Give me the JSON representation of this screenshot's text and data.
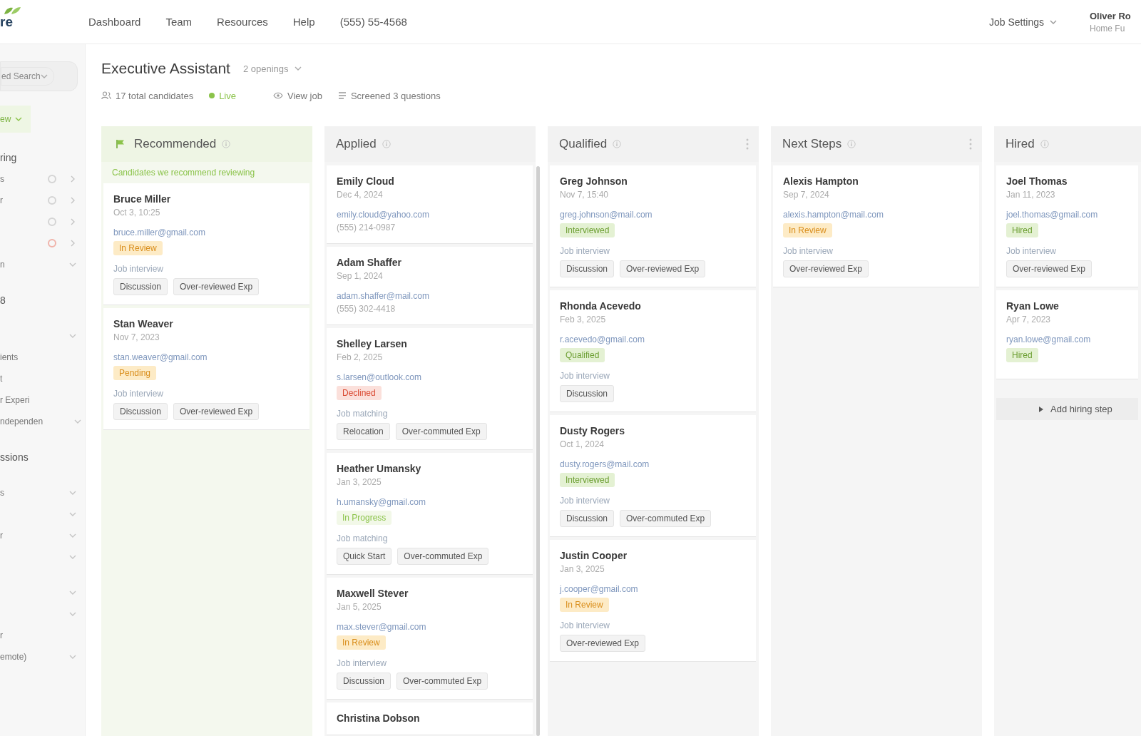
{
  "topbar": {
    "logo_text": "re",
    "nav": [
      "Dashboard",
      "Team",
      "Resources",
      "Help",
      "(555) 55-4568"
    ],
    "settings": "Job Settings",
    "user": {
      "name": "Oliver Ro",
      "company": "Home Fu"
    }
  },
  "sidebar": {
    "groups": [
      {
        "items": [
          {
            "kind": "dropdown",
            "text": "ed Search"
          }
        ]
      },
      {
        "items": [
          {
            "kind": "tag",
            "text": "ew"
          }
        ]
      },
      {
        "items": [
          {
            "kind": "heading",
            "text": "ring"
          },
          {
            "kind": "status",
            "text": "s",
            "color": "#d4d4d4"
          },
          {
            "kind": "status",
            "text": "r",
            "color": "#d4d4d4"
          },
          {
            "kind": "status",
            "color": "#d4d4d4"
          },
          {
            "kind": "status",
            "color": "#f0b3aa"
          },
          {
            "kind": "toggle",
            "text": "n"
          }
        ]
      },
      {
        "items": [
          {
            "kind": "heading",
            "text": "8"
          }
        ]
      },
      {
        "items": [
          {
            "kind": "toggle"
          },
          {
            "kind": "option",
            "text": "ients"
          },
          {
            "kind": "option",
            "text": "t"
          },
          {
            "kind": "option",
            "text": "r Experi"
          },
          {
            "kind": "toggle",
            "text": "ndependen"
          }
        ]
      },
      {
        "items": [
          {
            "kind": "heading",
            "text": "ssions"
          }
        ]
      },
      {
        "items": [
          {
            "kind": "toggle",
            "text": "s"
          },
          {
            "kind": "toggle"
          },
          {
            "kind": "toggle",
            "text": "r"
          },
          {
            "kind": "toggle"
          }
        ]
      },
      {
        "items": [
          {
            "kind": "toggle"
          },
          {
            "kind": "toggle"
          },
          {
            "kind": "option",
            "text": "r"
          },
          {
            "kind": "toggle",
            "text": "emote)"
          }
        ]
      }
    ]
  },
  "job": {
    "title": "Executive Assistant",
    "openings": "2 openings",
    "meta": [
      {
        "kind": "count",
        "text": "17 total candidates"
      },
      {
        "kind": "live",
        "text": "Live"
      },
      {
        "kind": "view",
        "text": "View job"
      },
      {
        "kind": "questions",
        "text": "Screened 3 questions"
      }
    ]
  },
  "columns": [
    {
      "kind": "recommended",
      "title": "Recommended",
      "note": "Candidates we recommend reviewing",
      "menu": false,
      "scrollable": false,
      "cards": [
        {
          "name": "Bruce Miller",
          "date": "Oct 3, 10:25",
          "email": "bruce.miller@gmail.com",
          "status": {
            "kind": "review",
            "label": "In Review"
          },
          "label": "Job interview",
          "tags": [
            "Discussion",
            "Over-reviewed Exp"
          ]
        },
        {
          "name": "Stan Weaver",
          "date": "Nov 7, 2023",
          "email": "stan.weaver@gmail.com",
          "status": {
            "kind": "review",
            "label": "Pending"
          },
          "label": "Job interview",
          "tags": [
            "Discussion",
            "Over-reviewed Exp"
          ]
        }
      ]
    },
    {
      "kind": "stage",
      "title": "Applied",
      "menu": false,
      "scrollable": true,
      "cards": [
        {
          "name": "Emily Cloud",
          "date": "Dec 4, 2024",
          "email": "emily.cloud@yahoo.com",
          "phone": "(555) 214-0987"
        },
        {
          "name": "Adam Shaffer",
          "date": "Sep 1, 2024",
          "email": "adam.shaffer@mail.com",
          "phone": "(555) 302-4418"
        },
        {
          "name": "Shelley Larsen",
          "date": "Feb 2, 2025",
          "email": "s.larsen@outlook.com",
          "status": {
            "kind": "declined",
            "label": "Declined"
          },
          "label": "Job matching",
          "tags": [
            "Relocation",
            "Over-commuted Exp"
          ]
        },
        {
          "name": "Heather Umansky",
          "date": "Jan 3, 2025",
          "email": "h.umansky@gmail.com",
          "status": {
            "kind": "progress",
            "label": "In Progress"
          },
          "label": "Job matching",
          "tags": [
            "Quick Start",
            "Over-commuted Exp"
          ]
        },
        {
          "name": "Maxwell Stever",
          "date": "Jan 5, 2025",
          "email": "max.stever@gmail.com",
          "status": {
            "kind": "review",
            "label": "In Review"
          },
          "label": "Job interview",
          "tags": [
            "Discussion",
            "Over-commuted Exp"
          ]
        },
        {
          "name": "Christina Dobson"
        }
      ]
    },
    {
      "kind": "stage",
      "title": "Qualified",
      "menu": true,
      "scrollable": false,
      "cards": [
        {
          "name": "Greg Johnson",
          "date": "Nov 7, 15:40",
          "email": "greg.johnson@mail.com",
          "status": {
            "kind": "qualified",
            "label": "Interviewed"
          },
          "label": "Job interview",
          "tags": [
            "Discussion",
            "Over-reviewed Exp"
          ]
        },
        {
          "name": "Rhonda Acevedo",
          "date": "Feb 3, 2025",
          "email": "r.acevedo@gmail.com",
          "status": {
            "kind": "qualified",
            "label": "Qualified"
          },
          "label": "Job interview",
          "tags": [
            "Discussion"
          ]
        },
        {
          "name": "Dusty Rogers",
          "date": "Oct 1, 2024",
          "email": "dusty.rogers@mail.com",
          "status": {
            "kind": "qualified",
            "label": "Interviewed"
          },
          "label": "Job interview",
          "tags": [
            "Discussion",
            "Over-commuted Exp"
          ]
        },
        {
          "name": "Justin Cooper",
          "date": "Jan 3, 2025",
          "email": "j.cooper@gmail.com",
          "status": {
            "kind": "review",
            "label": "In Review"
          },
          "label": "Job interview",
          "tags": [
            "Over-reviewed Exp"
          ]
        }
      ]
    },
    {
      "kind": "stage",
      "title": "Next Steps",
      "menu": true,
      "scrollable": false,
      "cards": [
        {
          "name": "Alexis Hampton",
          "date": "Sep 7, 2024",
          "email": "alexis.hampton@mail.com",
          "status": {
            "kind": "review",
            "label": "In Review"
          },
          "label": "Job interview",
          "tags": [
            "Over-reviewed Exp"
          ]
        }
      ]
    },
    {
      "kind": "stage",
      "title": "Hired",
      "menu": false,
      "scrollable": false,
      "add_button": "Add hiring step",
      "cards": [
        {
          "name": "Joel Thomas",
          "date": "Jan 11, 2023",
          "email": "joel.thomas@gmail.com",
          "status": {
            "kind": "qualified",
            "label": "Hired"
          },
          "label": "Job interview",
          "tags": [
            "Over-reviewed Exp"
          ]
        },
        {
          "name": "Ryan Lowe",
          "date": "Apr 7, 2023",
          "email": "ryan.lowe@gmail.com",
          "status": {
            "kind": "qualified",
            "label": "Hired"
          }
        }
      ]
    }
  ]
}
